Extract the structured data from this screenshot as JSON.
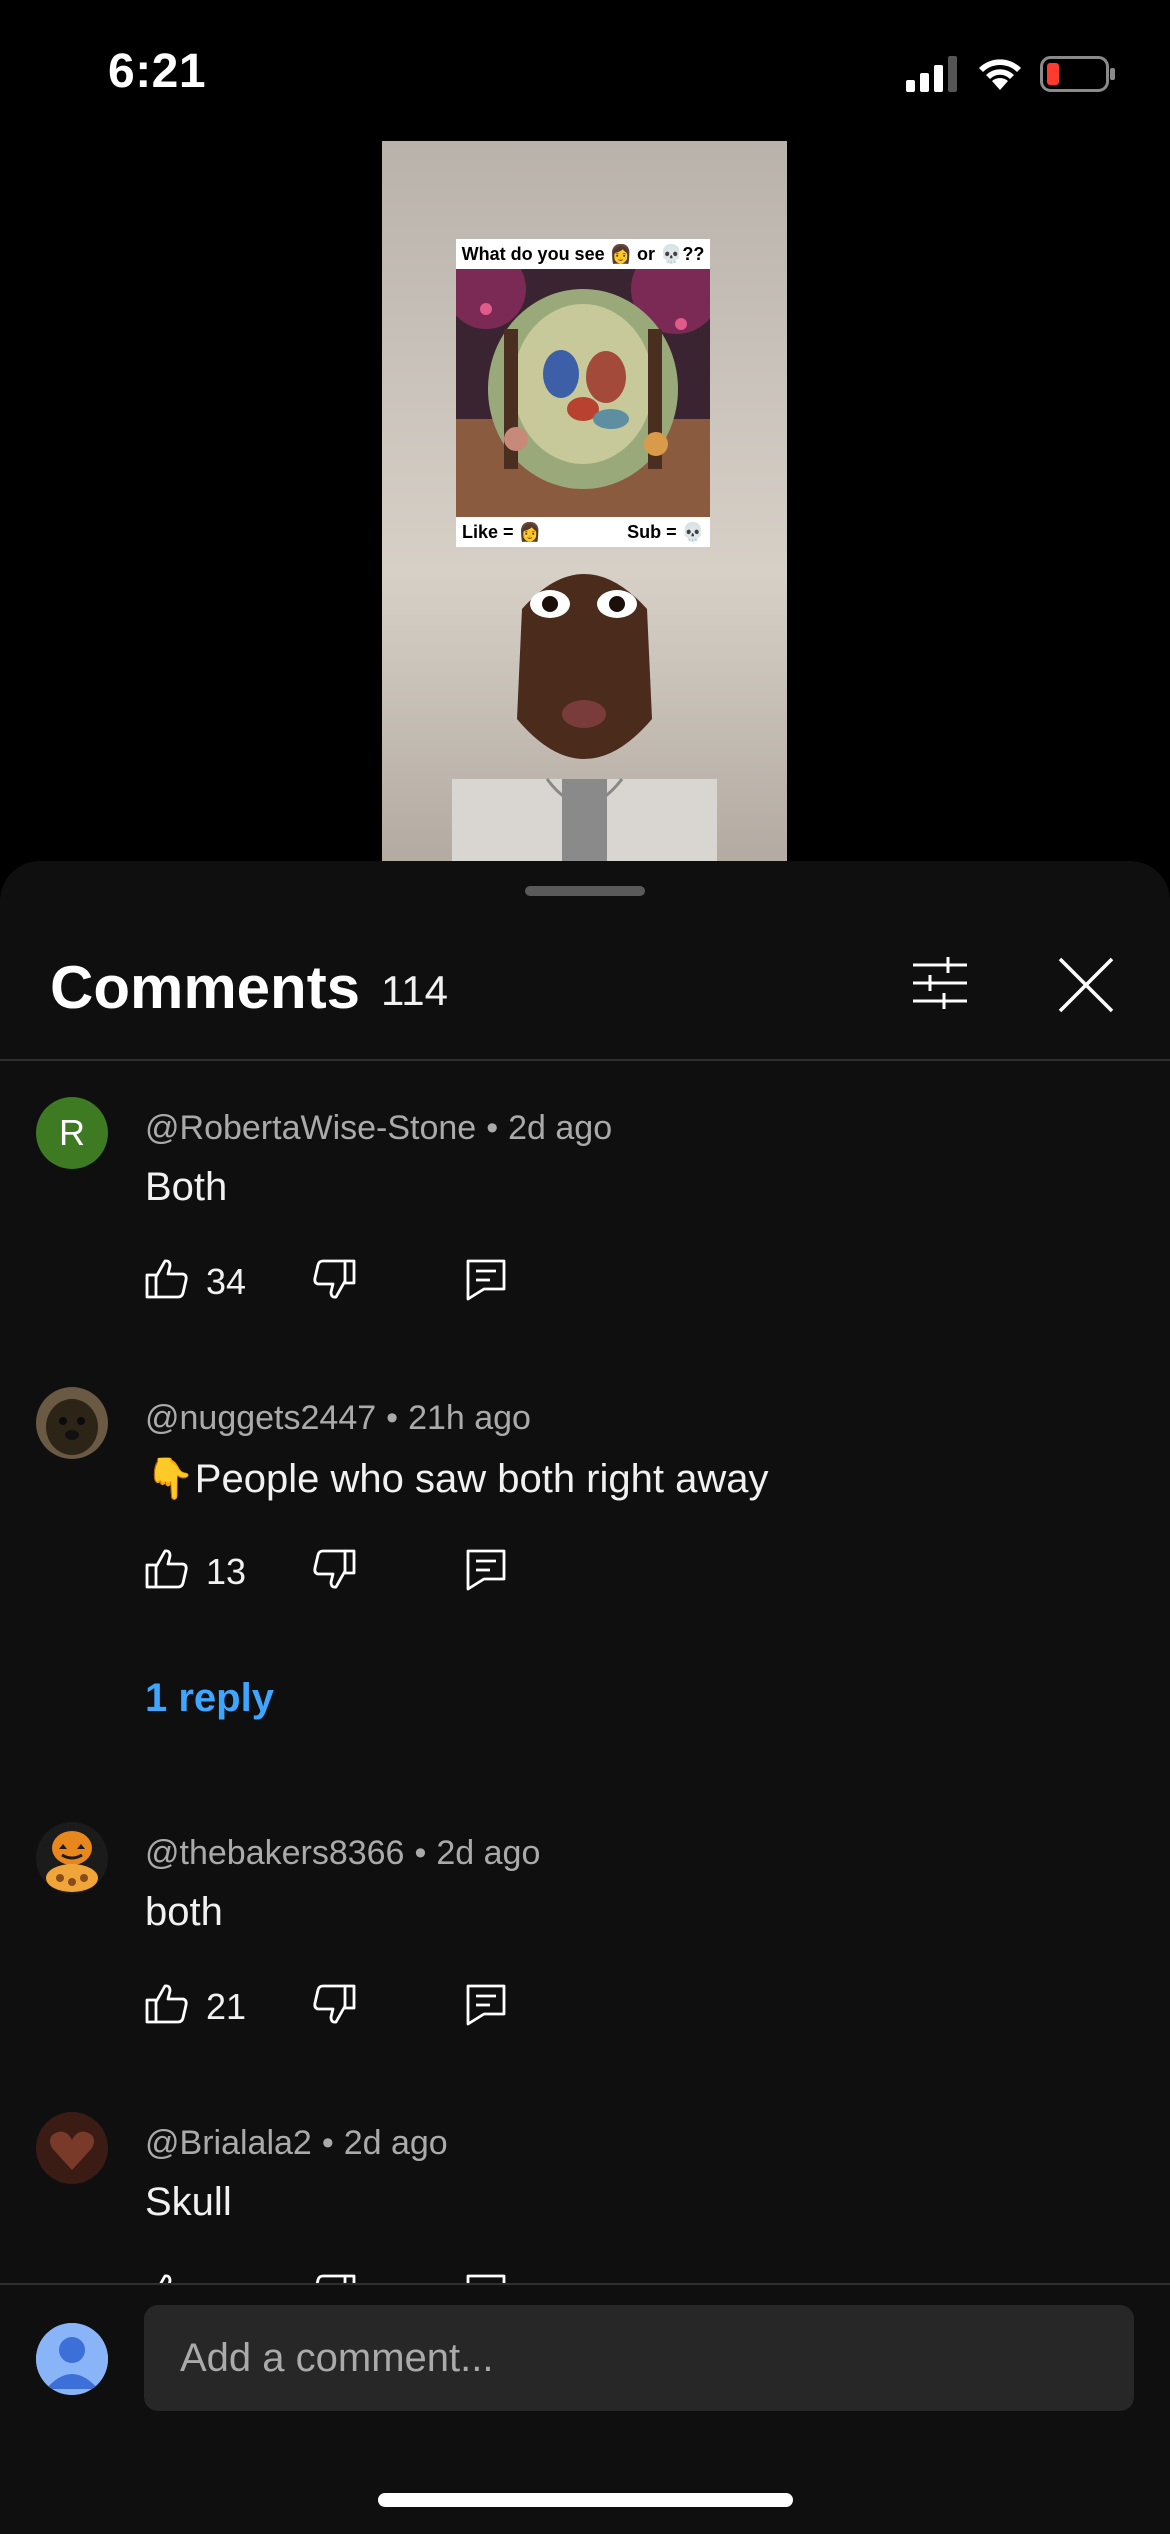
{
  "status_bar": {
    "time": "6:21"
  },
  "video": {
    "card_question": "What do you see 👩 or 💀??",
    "card_like": "Like = 👩",
    "card_sub": "Sub = 💀"
  },
  "comments_panel": {
    "title": "Comments",
    "count": "114",
    "add_comment_placeholder": "Add a comment..."
  },
  "comments": [
    {
      "author": "@RobertaWise-Stone",
      "time": "2d ago",
      "text": "Both",
      "likes": "34",
      "avatar_letter": "R"
    },
    {
      "author": "@nuggets2447",
      "time": "21h ago",
      "text": "👇People who saw both right away",
      "likes": "13",
      "replies": "1 reply"
    },
    {
      "author": "@thebakers8366",
      "time": "2d ago",
      "text": "both",
      "likes": "21"
    },
    {
      "author": "@Brialala2",
      "time": "2d ago",
      "text": "Skull",
      "likes": ""
    }
  ],
  "colors": {
    "background": "#0f0f0f",
    "link": "#3ea6ff",
    "secondary_text": "#aaaaaa",
    "avatar_green": "#3e7a22"
  }
}
